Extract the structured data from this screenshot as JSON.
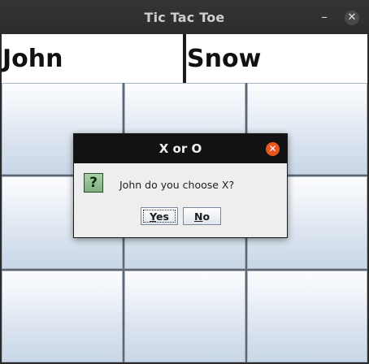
{
  "window": {
    "title": "Tic Tac Toe",
    "minimize_glyph": "–",
    "close_glyph": "✕"
  },
  "players": {
    "left": "John",
    "right": "Snow"
  },
  "board": {
    "cells": [
      "",
      "",
      "",
      "",
      "",
      "",
      "",
      "",
      ""
    ]
  },
  "dialog": {
    "title": "X or O",
    "close_glyph": "✕",
    "icon_text": "?",
    "message": "John do you choose X?",
    "yes_mnemonic": "Y",
    "yes_rest": "es",
    "no_mnemonic": "N",
    "no_rest": "o"
  },
  "colors": {
    "dialog_close": "#e95420",
    "title_bar": "#2c2c2c"
  },
  "icons": {
    "window_close": "close-icon",
    "window_minimize": "minimize-icon",
    "dialog_close": "close-icon",
    "question": "question-icon"
  }
}
